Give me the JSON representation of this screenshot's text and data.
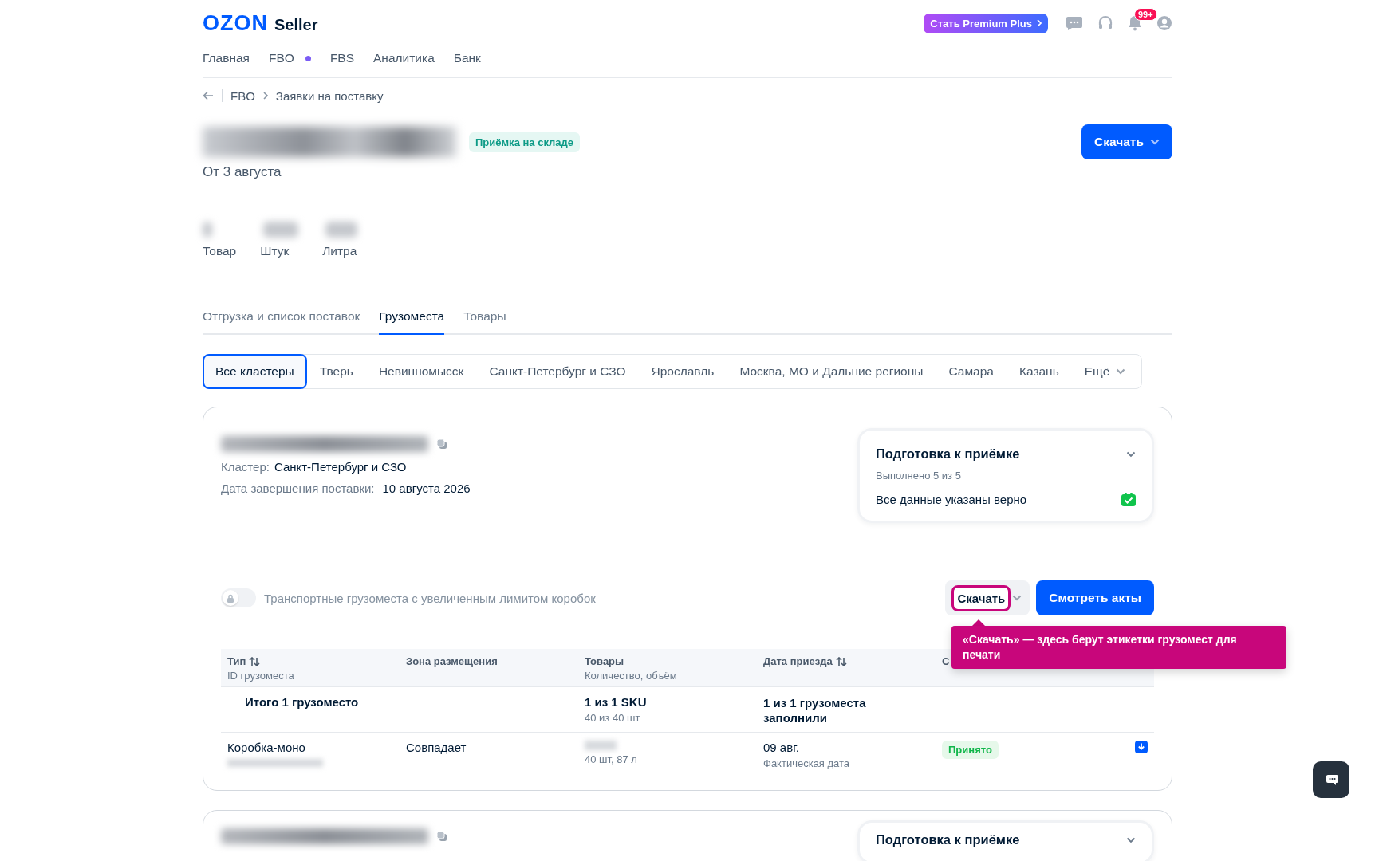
{
  "header": {
    "logo": "OZON",
    "logo_suffix": "Seller",
    "premium_button": "Стать Premium Plus",
    "notification_badge": "99+"
  },
  "nav": [
    {
      "label": "Главная",
      "dot": false
    },
    {
      "label": "FBO",
      "dot": true
    },
    {
      "label": "FBS",
      "dot": false
    },
    {
      "label": "Аналитика",
      "dot": false
    },
    {
      "label": "Банк",
      "dot": false
    }
  ],
  "breadcrumbs": [
    "FBO",
    "Заявки на поставку"
  ],
  "page": {
    "status_badge": "Приёмка на складе",
    "date": "От 3 августа",
    "download_button": "Скачать"
  },
  "stats": [
    {
      "label": "Товар"
    },
    {
      "label": "Штук"
    },
    {
      "label": "Литра"
    }
  ],
  "tabs": [
    {
      "label": "Отгрузка и список поставок",
      "selected": false
    },
    {
      "label": "Грузоместа",
      "selected": true
    },
    {
      "label": "Товары",
      "selected": false
    }
  ],
  "clusters": [
    {
      "label": "Все кластеры",
      "selected": true
    },
    {
      "label": "Тверь",
      "selected": false
    },
    {
      "label": "Невинномысск",
      "selected": false
    },
    {
      "label": "Санкт-Петербург и СЗО",
      "selected": false
    },
    {
      "label": "Ярославль",
      "selected": false
    },
    {
      "label": "Москва, МО и Дальние регионы",
      "selected": false
    },
    {
      "label": "Самара",
      "selected": false
    },
    {
      "label": "Казань",
      "selected": false
    }
  ],
  "clusters_more": "Ещё",
  "cards": [
    {
      "cluster_label": "Кластер:",
      "cluster": "Санкт-Петербург и СЗО",
      "date_label": "Дата завершения поставки:",
      "date": "10 августа 2026",
      "checklist": {
        "title": "Подготовка к приёмке",
        "progress": "Выполнено 5 из 5",
        "item": "Все данные указаны верно",
        "done": true
      },
      "toggle": {
        "label": "Транспортные грузоместа с увеличенным лимитом коробок",
        "on": false
      },
      "download_button": "Скачать",
      "acts_button": "Смотреть акты",
      "table": {
        "columns": [
          {
            "title": "Тип",
            "subtitle": "ID грузоместа",
            "sortable": true
          },
          {
            "title": "Зона размещения",
            "sortable": false
          },
          {
            "title": "Товары",
            "subtitle": "Количество, объём",
            "sortable": false
          },
          {
            "title": "Дата приезда",
            "sortable": true
          },
          {
            "title": "С"
          }
        ],
        "summary": {
          "label": "Итого 1 грузоместо",
          "goods": "1 из 1 SKU",
          "goods_sub": "40 из 40 шт",
          "date": "1 из 1 грузоместа заполнили"
        },
        "rows": [
          {
            "type": "Коробка-моно",
            "zone": "Совпадает",
            "goods_sub": "40 шт, 87 л",
            "date": "09 авг.",
            "date_sub": "Фактическая дата",
            "status": "Принято"
          }
        ]
      }
    },
    {
      "checklist": {
        "title": "Подготовка к приёмке"
      }
    }
  ],
  "tooltip": {
    "text": "«Скачать» — здесь берут этикетки грузомест для печати"
  }
}
